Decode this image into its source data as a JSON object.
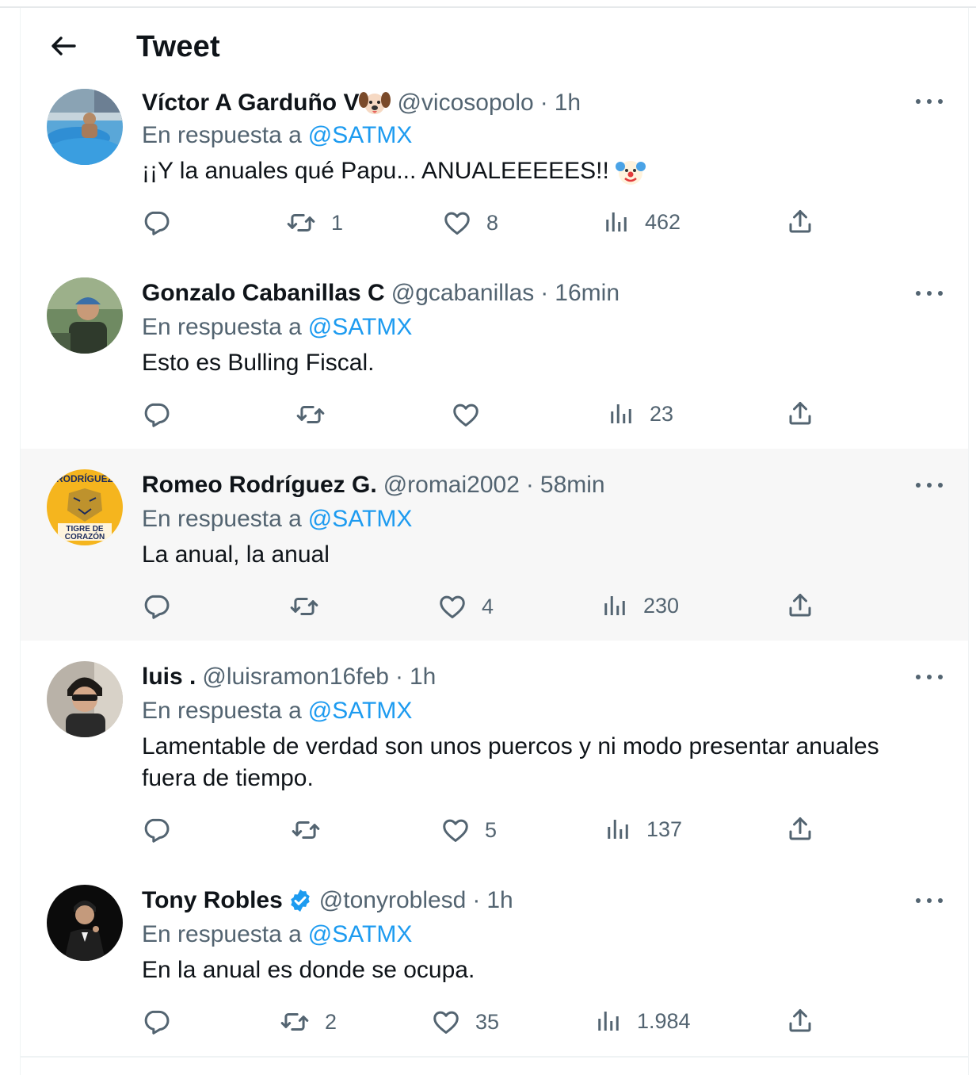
{
  "header": {
    "title": "Tweet"
  },
  "tweets": [
    {
      "name": "Víctor A Garduño V",
      "handle": "@vicosopolo",
      "time": "1h",
      "reply_prefix": "En respuesta a",
      "reply_to": "@SATMX",
      "text": "¡¡Y la anuales qué Papu... ANUALEEEEES!!",
      "retweets": "1",
      "likes": "8",
      "views": "462"
    },
    {
      "name": "Gonzalo Cabanillas C",
      "handle": "@gcabanillas",
      "time": "16min",
      "reply_prefix": "En respuesta a",
      "reply_to": "@SATMX",
      "text": "Esto es Bulling Fiscal.",
      "retweets": "",
      "likes": "",
      "views": "23"
    },
    {
      "name": "Romeo Rodríguez G.",
      "handle": "@romai2002",
      "time": "58min",
      "reply_prefix": "En respuesta a",
      "reply_to": "@SATMX",
      "text": "La anual, la anual",
      "retweets": "",
      "likes": "4",
      "views": "230",
      "avatar_text_top": "RODRÍGUEZ",
      "avatar_text_bottom_1": "TIGRE DE",
      "avatar_text_bottom_2": "CORAZÓN"
    },
    {
      "name": "luis .",
      "handle": "@luisramon16feb",
      "time": "1h",
      "reply_prefix": "En respuesta a",
      "reply_to": "@SATMX",
      "text": "Lamentable de verdad son unos puercos y ni modo presentar anuales fuera de tiempo.",
      "retweets": "",
      "likes": "5",
      "views": "137"
    },
    {
      "name": "Tony Robles",
      "handle": "@tonyroblesd",
      "time": "1h",
      "reply_prefix": "En respuesta a",
      "reply_to": "@SATMX",
      "text": "En la anual es donde se ocupa.",
      "retweets": "2",
      "likes": "35",
      "views": "1.984"
    }
  ],
  "colors": {
    "accent": "#1d9bf0",
    "muted": "#536471",
    "text": "#0f1419",
    "highlight_bg": "#f7f7f7",
    "tiger_yellow": "#f5b51e",
    "verified": "#1d9bf0"
  },
  "icons": [
    "arrow-left-icon",
    "more-icon",
    "reply-icon",
    "retweet-icon",
    "like-icon",
    "views-icon",
    "share-icon",
    "verified-badge-icon",
    "dog-emoji-icon",
    "clown-emoji-icon"
  ]
}
